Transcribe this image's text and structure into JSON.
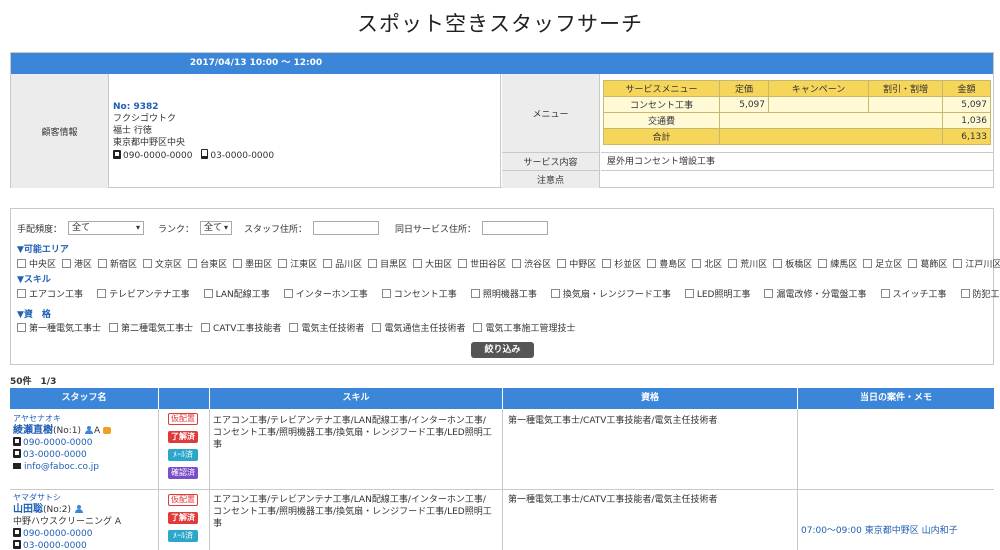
{
  "title": "スポット空きスタッフサーチ",
  "info": {
    "datetime": "2017/04/13  10:00 〜 12:00",
    "customer_label": "顧客情報",
    "customer": {
      "no": "No: 9382",
      "kana": "フクシゴウトク",
      "name": "福士 行徳",
      "address": "東京都中野区中央",
      "tel": "090-0000-0000",
      "mobile": "03-0000-0000"
    },
    "menu_label": "メニュー",
    "service_label": "サービス内容",
    "service_value": "屋外用コンセント増設工事",
    "note_label": "注意点",
    "menu_table": {
      "headers": [
        "サービスメニュー",
        "定価",
        "キャンペーン",
        "割引・割増",
        "金額"
      ],
      "rows": [
        [
          "コンセント工事",
          "5,097",
          "",
          "",
          "5,097"
        ],
        [
          "交通費",
          "",
          "",
          "",
          "1,036"
        ]
      ],
      "total_label": "合計",
      "total": "6,133"
    }
  },
  "filter": {
    "freq_label": "手配頻度：",
    "freq_value": "全て",
    "rank_label": "ランク：",
    "rank_value": "全て",
    "staff_addr_label": "スタッフ住所：",
    "sameday_addr_label": "同日サービス住所：",
    "area_title": "▼可能エリア",
    "areas": [
      "中央区",
      "港区",
      "新宿区",
      "文京区",
      "台東区",
      "墨田区",
      "江東区",
      "品川区",
      "目黒区",
      "大田区",
      "世田谷区",
      "渋谷区",
      "中野区",
      "杉並区",
      "豊島区",
      "北区",
      "荒川区",
      "板橋区",
      "練馬区",
      "足立区",
      "葛飾区",
      "江戸川区"
    ],
    "skill_title": "▼スキル",
    "skills": [
      "エアコン工事",
      "テレビアンテナ工事",
      "LAN配線工事",
      "インターホン工事",
      "コンセント工事",
      "照明機器工事",
      "換気扇・レンジフード工事",
      "LED照明工事",
      "漏電改修・分電盤工事",
      "スイッチ工事",
      "防犯工事"
    ],
    "qual_title": "▼資　格",
    "quals": [
      "第一種電気工事士",
      "第二種電気工事士",
      "CATV工事技能者",
      "電気主任技術者",
      "電気通信主任技術者",
      "電気工事施工管理技士"
    ],
    "search_button": "絞り込み"
  },
  "result_count": "50件　1/3",
  "staff_table": {
    "headers": [
      "スタッフ名",
      "スキル",
      "資格",
      "当日の案件・メモ"
    ],
    "rows": [
      {
        "kana": "アヤセナオキ",
        "name": "綾瀬直樹",
        "no": "(No:1)",
        "rank": "A",
        "company": "",
        "tel": "090-0000-0000",
        "mobile": "03-0000-0000",
        "email": "info@faboc.co.jp",
        "tags": [
          "仮配置",
          "了解済",
          "ﾒｰﾙ済",
          "確認済"
        ],
        "skills": "エアコン工事/テレビアンテナ工事/LAN配線工事/インターホン工事/コンセント工事/照明機器工事/換気扇・レンジフード工事/LED照明工事",
        "quals": "第一種電気工事士/CATV工事技能者/電気主任技術者",
        "memo": ""
      },
      {
        "kana": "ヤマダサトシ",
        "name": "山田聡",
        "no": "(No:2)",
        "rank": "A",
        "company": "中野ハウスクリーニング",
        "tel": "090-0000-0000",
        "mobile": "03-0000-0000",
        "email": "",
        "tags": [
          "仮配置",
          "了解済",
          "ﾒｰﾙ済"
        ],
        "skills": "エアコン工事/テレビアンテナ工事/LAN配線工事/インターホン工事/コンセント工事/照明機器工事/換気扇・レンジフード工事/LED照明工事",
        "quals": "第一種電気工事士/CATV工事技能者/電気主任技術者",
        "memo": "07:00〜09:00 東京都中野区 山内和子"
      }
    ]
  }
}
